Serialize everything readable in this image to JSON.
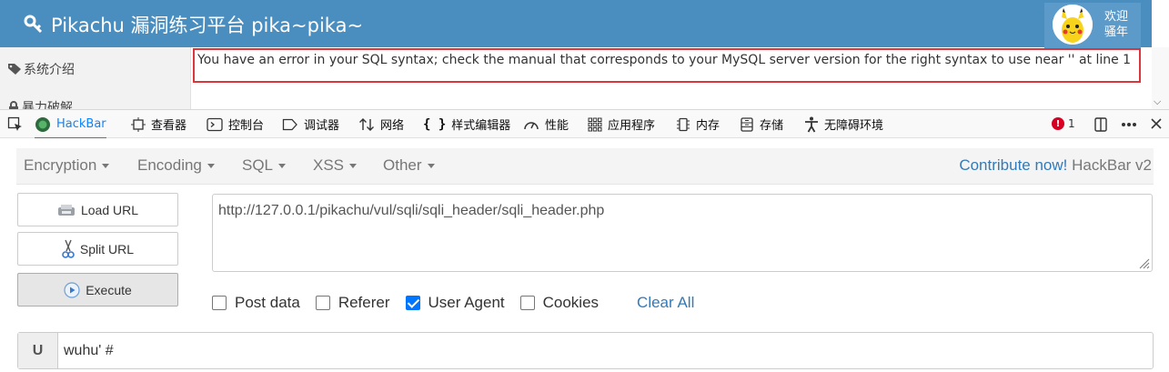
{
  "header": {
    "brand": "Pikachu 漏洞练习平台 pika~pika~",
    "welcome": "欢迎骚年",
    "brand_color": "#4a8ec0"
  },
  "sidebar": {
    "items": [
      {
        "label": "系统介绍",
        "icon": "tag-icon"
      },
      {
        "label": "暴力破解",
        "icon": "lock-icon"
      }
    ]
  },
  "error": {
    "message": "You have an error in your SQL syntax; check the manual that corresponds to your MySQL server version for the right syntax to use near '' at line 1",
    "border_color": "#d9363e"
  },
  "devtools": {
    "tabs": [
      {
        "label": "HackBar",
        "icon": "hackbar-icon",
        "active": true
      },
      {
        "label": "查看器",
        "icon": "inspector-icon"
      },
      {
        "label": "控制台",
        "icon": "console-icon"
      },
      {
        "label": "调试器",
        "icon": "debugger-icon"
      },
      {
        "label": "网络",
        "icon": "network-icon"
      },
      {
        "label": "样式编辑器",
        "icon": "style-editor-icon"
      },
      {
        "label": "性能",
        "icon": "performance-icon"
      },
      {
        "label": "应用程序",
        "icon": "application-icon"
      },
      {
        "label": "内存",
        "icon": "memory-icon"
      },
      {
        "label": "存储",
        "icon": "storage-icon"
      },
      {
        "label": "无障碍环境",
        "icon": "accessibility-icon"
      }
    ],
    "error_count": "1",
    "accent_color": "#0a84ff"
  },
  "hackbar": {
    "menus": [
      "Encryption",
      "Encoding",
      "SQL",
      "XSS",
      "Other"
    ],
    "contribute_link": "Contribute now!",
    "version": "HackBar v2",
    "buttons": {
      "load": "Load URL",
      "split": "Split URL",
      "execute": "Execute"
    },
    "url": "http://127.0.0.1/pikachu/vul/sqli/sqli_header/sqli_header.php",
    "options": [
      {
        "label": "Post data",
        "checked": false
      },
      {
        "label": "Referer",
        "checked": false
      },
      {
        "label": "User Agent",
        "checked": true
      },
      {
        "label": "Cookies",
        "checked": false
      }
    ],
    "clear_all": "Clear All",
    "user_agent": {
      "label": "U",
      "value": "wuhu' #"
    }
  }
}
